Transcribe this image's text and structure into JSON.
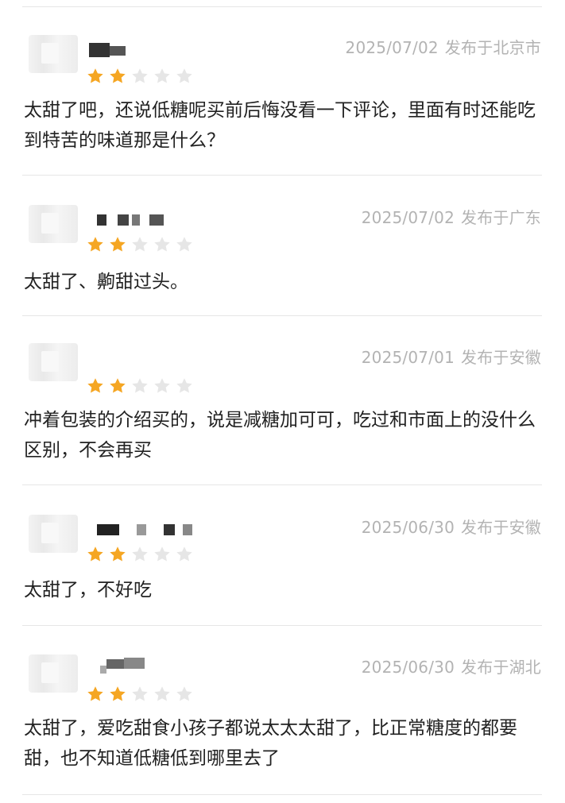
{
  "colors": {
    "star_filled": "#f5a623",
    "star_empty": "#e6e6e6",
    "meta_text": "#b3b3b3",
    "body_text": "#222222",
    "divider": "#e6e6e6"
  },
  "reviews": [
    {
      "date": "2025/07/02",
      "location": "发布于北京市",
      "rating": 2,
      "max_rating": 5,
      "text": "太甜了吧，还说低糖呢买前后悔没看一下评论，里面有时还能吃到特苦的味道那是什么？"
    },
    {
      "date": "2025/07/02",
      "location": "发布于广东",
      "rating": 2,
      "max_rating": 5,
      "text": "太甜了、齁甜过头。"
    },
    {
      "date": "2025/07/01",
      "location": "发布于安徽",
      "rating": 2,
      "max_rating": 5,
      "text": "冲着包装的介绍买的，说是减糖加可可，吃过和市面上的没什么区别，不会再买"
    },
    {
      "date": "2025/06/30",
      "location": "发布于安徽",
      "rating": 2,
      "max_rating": 5,
      "text": "太甜了，不好吃"
    },
    {
      "date": "2025/06/30",
      "location": "发布于湖北",
      "rating": 2,
      "max_rating": 5,
      "text": "太甜了，爱吃甜食小孩子都说太太太甜了，比正常糖度的都要甜，也不知道低糖低到哪里去了"
    }
  ]
}
